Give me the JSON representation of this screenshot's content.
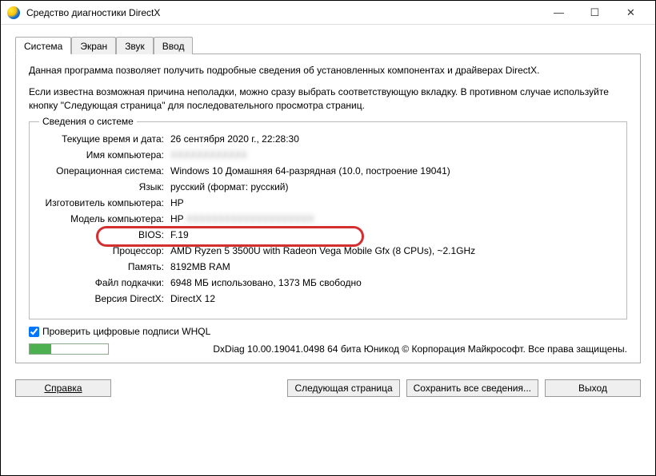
{
  "window": {
    "title": "Средство диагностики DirectX"
  },
  "tabs": {
    "items": [
      {
        "label": "Система"
      },
      {
        "label": "Экран"
      },
      {
        "label": "Звук"
      },
      {
        "label": "Ввод"
      }
    ]
  },
  "intro": {
    "line1": "Данная программа позволяет получить подробные сведения об установленных компонентах и драйверах DirectX.",
    "line2": "Если известна возможная причина неполадки, можно сразу выбрать соответствующую вкладку. В противном случае используйте кнопку \"Следующая страница\" для последовательного просмотра страниц."
  },
  "sysinfo": {
    "legend": "Сведения о системе",
    "rows": {
      "datetime_label": "Текущие время и дата:",
      "datetime_value": "26 сентября 2020 г., 22:28:30",
      "pcname_label": "Имя компьютера:",
      "pcname_value": "XXXXXXXXXXXX",
      "os_label": "Операционная система:",
      "os_value": "Windows 10 Домашняя 64-разрядная (10.0, построение 19041)",
      "lang_label": "Язык:",
      "lang_value": "русский (формат: русский)",
      "manuf_label": "Изготовитель компьютера:",
      "manuf_value": "HP",
      "model_label": "Модель компьютера:",
      "model_prefix": "HP",
      "model_rest": " XXXXXXXXXXXXXXXXXXXX",
      "bios_label": "BIOS:",
      "bios_value": "F.19",
      "cpu_label": "Процессор:",
      "cpu_value": "AMD Ryzen 5 3500U with Radeon Vega Mobile Gfx   (8 CPUs), ~2.1GHz",
      "ram_label": "Память:",
      "ram_value": "8192MB RAM",
      "pagefile_label": "Файл подкачки:",
      "pagefile_value": "6948 МБ использовано, 1373 МБ свободно",
      "dx_label": "Версия DirectX:",
      "dx_value": "DirectX 12"
    }
  },
  "checkbox": {
    "label": "Проверить цифровые подписи WHQL"
  },
  "footer": {
    "text": "DxDiag 10.00.19041.0498 64 бита Юникод © Корпорация Майкрософт. Все права защищены."
  },
  "buttons": {
    "help": "Справка",
    "next": "Следующая страница",
    "save": "Сохранить все сведения...",
    "exit": "Выход"
  }
}
